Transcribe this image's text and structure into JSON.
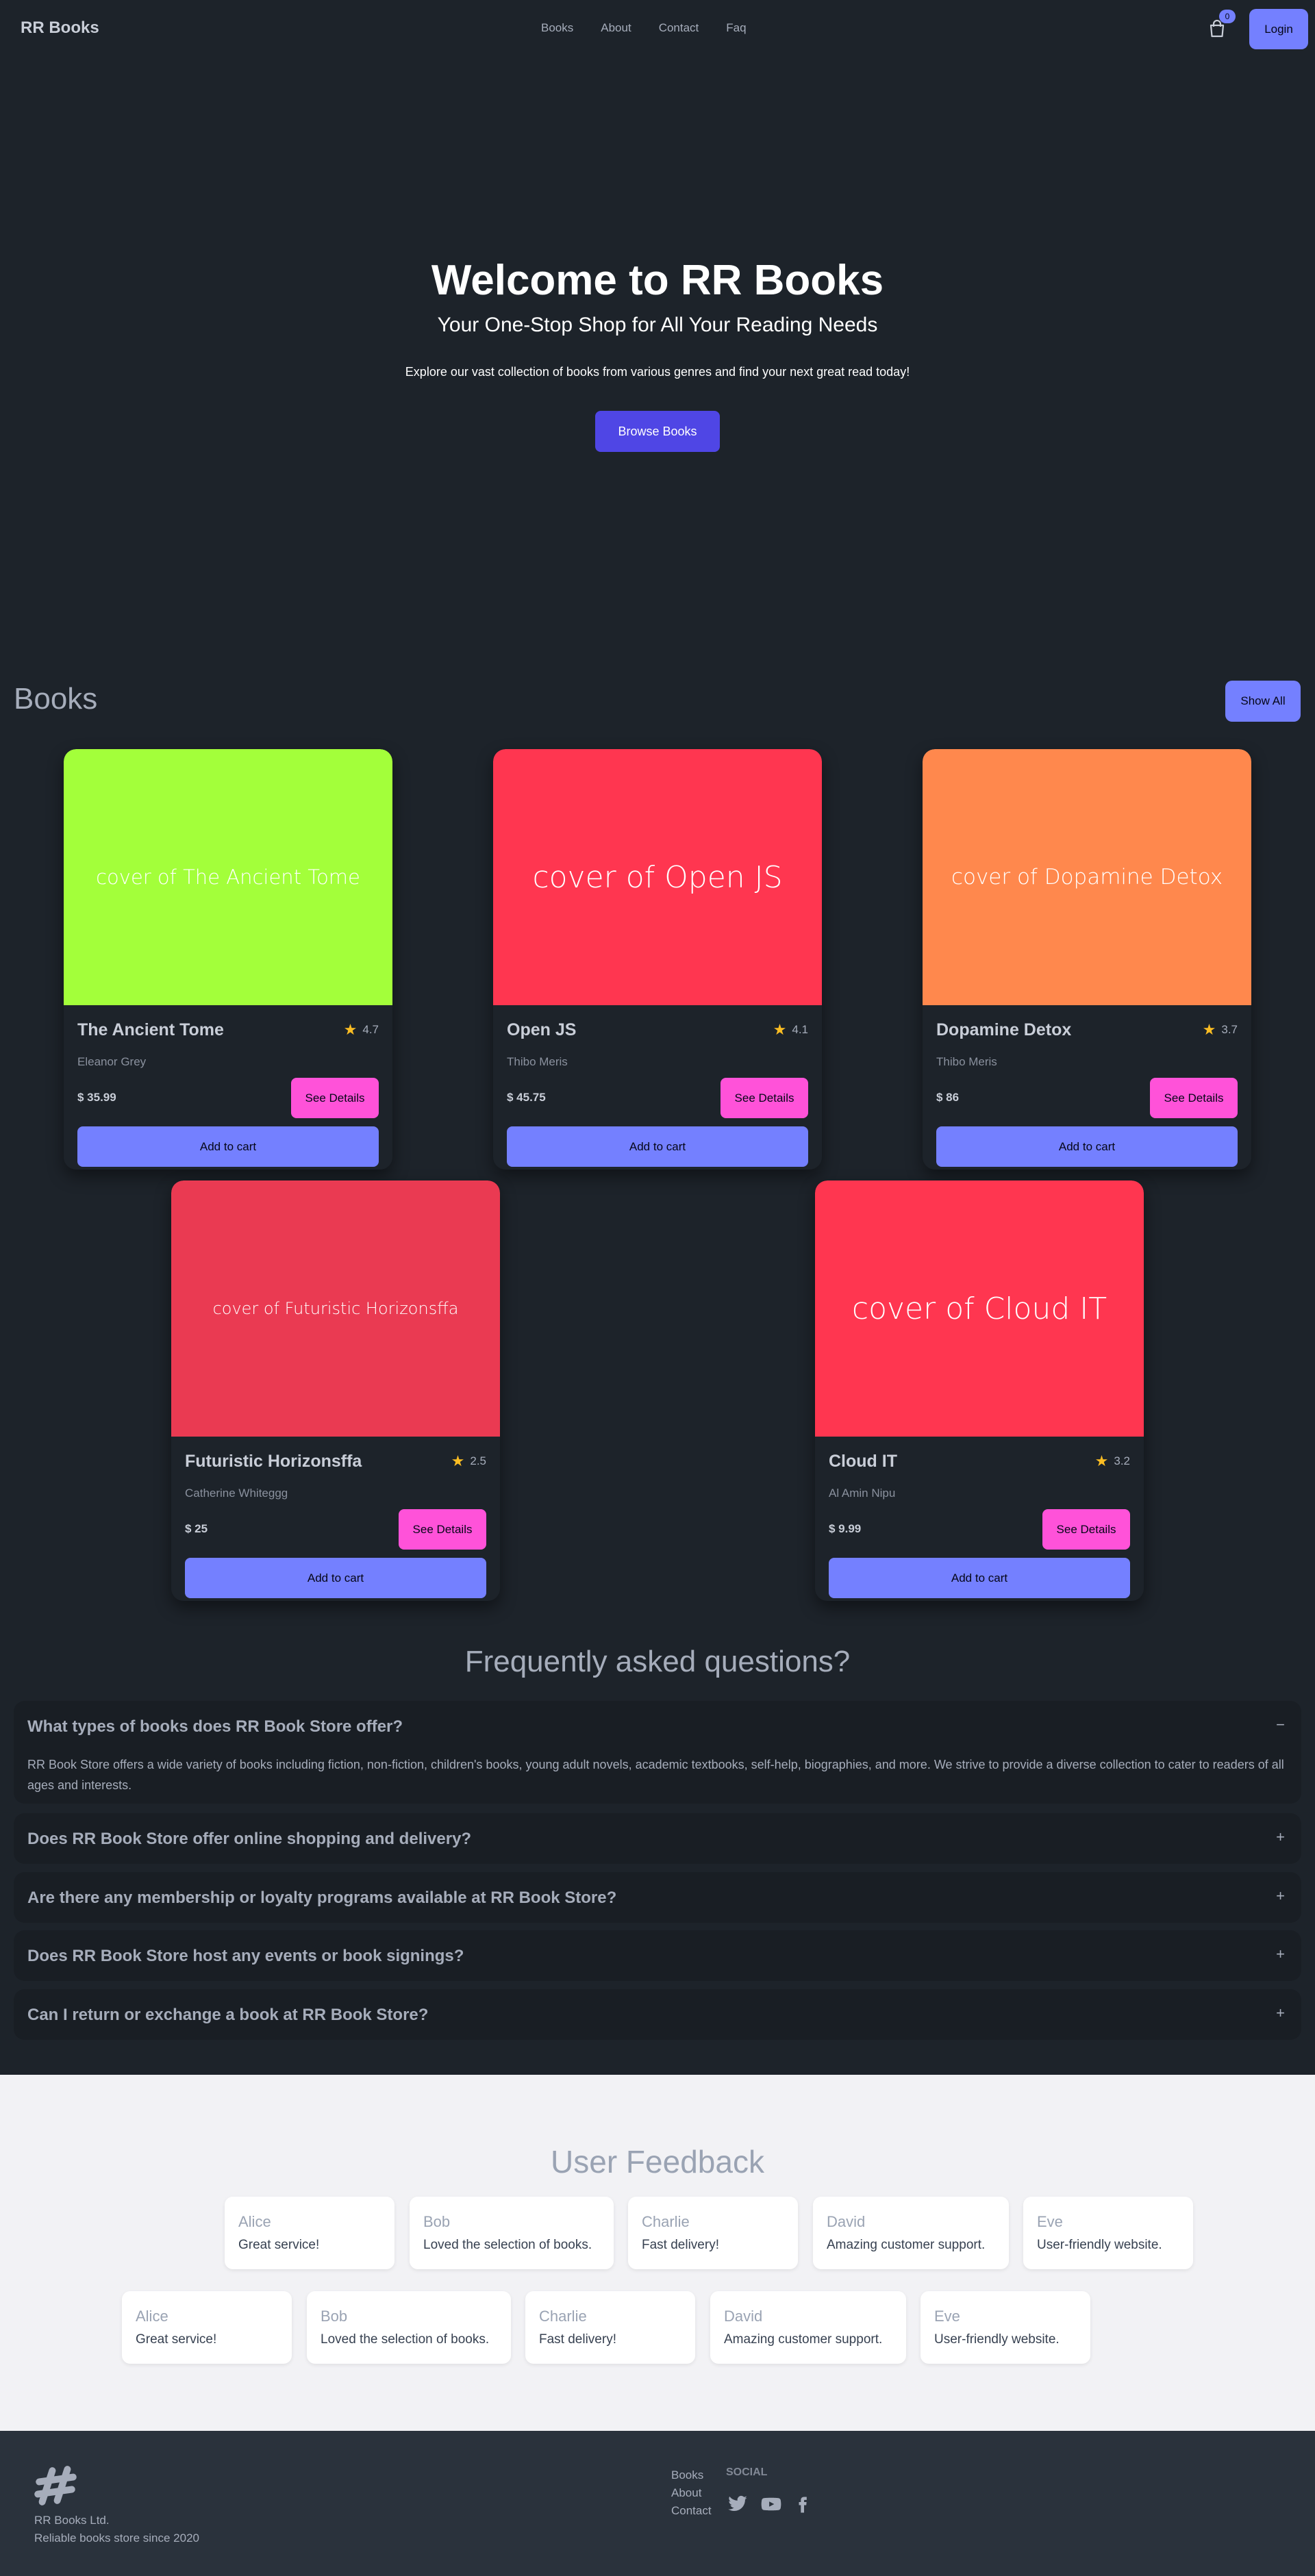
{
  "nav": {
    "brand": "RR Books",
    "links": [
      "Books",
      "About",
      "Contact",
      "Faq"
    ],
    "cart_count": "0",
    "login_label": "Login",
    "cart_icon": "shopping-bag-icon"
  },
  "hero": {
    "title": "Welcome to RR Books",
    "subtitle": "Your One-Stop Shop for All Your Reading Needs",
    "description": "Explore our vast collection of books from various genres and find your next great read today!",
    "button_label": "Browse Books"
  },
  "books_section": {
    "heading": "Books",
    "show_all_label": "Show All",
    "details_label": "See Details",
    "add_to_cart_label": "Add to cart",
    "books": [
      {
        "cover_text": "cover of The Ancient Tome",
        "cover_color": "#a3ff3a",
        "title": "The Ancient Tome",
        "rating": "4.7",
        "author": "Eleanor Grey",
        "price": "$ 35.99"
      },
      {
        "cover_text": "cover of Open JS",
        "cover_color": "#ff3650",
        "title": "Open JS",
        "rating": "4.1",
        "author": "Thibo Meris",
        "price": "$ 45.75"
      },
      {
        "cover_text": "cover of Dopamine Detox",
        "cover_color": "#ff884d",
        "title": "Dopamine Detox",
        "rating": "3.7",
        "author": "Thibo Meris",
        "price": "$ 86"
      },
      {
        "cover_text": "cover of Futuristic Horizonsffa",
        "cover_color": "#ea3a52",
        "title": "Futuristic Horizonsffa",
        "rating": "2.5",
        "author": "Catherine Whiteggg",
        "price": "$ 25"
      },
      {
        "cover_text": "cover of Cloud IT",
        "cover_color": "#ff3650",
        "title": "Cloud IT",
        "rating": "3.2",
        "author": "Al Amin Nipu",
        "price": "$ 9.99"
      }
    ]
  },
  "faq": {
    "heading": "Frequently asked questions?",
    "items": [
      {
        "question": "What types of books does RR Book Store offer?",
        "answer": "RR Book Store offers a wide variety of books including fiction, non-fiction, children's books, young adult novels, academic textbooks, self-help, biographies, and more. We strive to provide a diverse collection to cater to readers of all ages and interests.",
        "toggle": "−",
        "expanded": true
      },
      {
        "question": "Does RR Book Store offer online shopping and delivery?",
        "toggle": "+",
        "expanded": false
      },
      {
        "question": "Are there any membership or loyalty programs available at RR Book Store?",
        "toggle": "+",
        "expanded": false
      },
      {
        "question": "Does RR Book Store host any events or book signings?",
        "toggle": "+",
        "expanded": false
      },
      {
        "question": "Can I return or exchange a book at RR Book Store?",
        "toggle": "+",
        "expanded": false
      }
    ]
  },
  "feedback": {
    "heading": "User Feedback",
    "row1": [
      {
        "name": "Alice",
        "text": "Great service!"
      },
      {
        "name": "Bob",
        "text": "Loved the selection of books."
      },
      {
        "name": "Charlie",
        "text": "Fast delivery!"
      },
      {
        "name": "David",
        "text": "Amazing customer support."
      },
      {
        "name": "Eve",
        "text": "User-friendly website."
      }
    ],
    "row2": [
      {
        "name": "Alice",
        "text": "Great service!"
      },
      {
        "name": "Bob",
        "text": "Loved the selection of books."
      },
      {
        "name": "Charlie",
        "text": "Fast delivery!"
      },
      {
        "name": "David",
        "text": "Amazing customer support."
      },
      {
        "name": "Eve",
        "text": "User-friendly website."
      }
    ]
  },
  "footer": {
    "company_name": "RR Books Ltd.",
    "tagline": "Reliable books store since 2020",
    "links": [
      "Books",
      "About",
      "Contact"
    ],
    "social_title": "SOCIAL",
    "social_icons": [
      "twitter-icon",
      "youtube-icon",
      "facebook-icon"
    ]
  },
  "colors": {
    "background": "#1d232a",
    "primary": "#7480ff",
    "accent": "#ff52d9",
    "hero_button": "#4f46e5",
    "star": "#fbbd23"
  }
}
